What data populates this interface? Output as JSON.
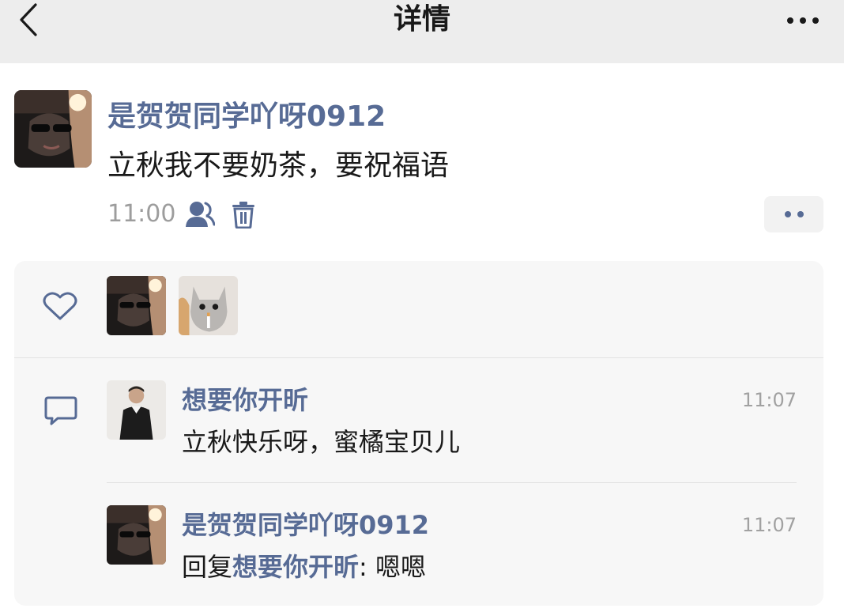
{
  "header": {
    "title": "详情"
  },
  "post": {
    "author": "是贺贺同学吖呀0912",
    "text": "立秋我不要奶茶，要祝福语",
    "time": "11:00"
  },
  "comments": [
    {
      "author": "想要你开昕",
      "text": "立秋快乐呀，蜜橘宝贝儿",
      "time": "11:07"
    },
    {
      "author": "是贺贺同学吖呀0912",
      "reply_prefix": "回复",
      "reply_to": "想要你开昕",
      "reply_text": ": 嗯嗯",
      "time": "11:07"
    }
  ],
  "colors": {
    "link_blue": "#576b95",
    "header_bg": "#ededed",
    "panel_bg": "#f7f7f7"
  },
  "icons": [
    "back-icon",
    "more-icon",
    "visibility-icon",
    "trash-icon",
    "like-icon",
    "comment-icon"
  ]
}
